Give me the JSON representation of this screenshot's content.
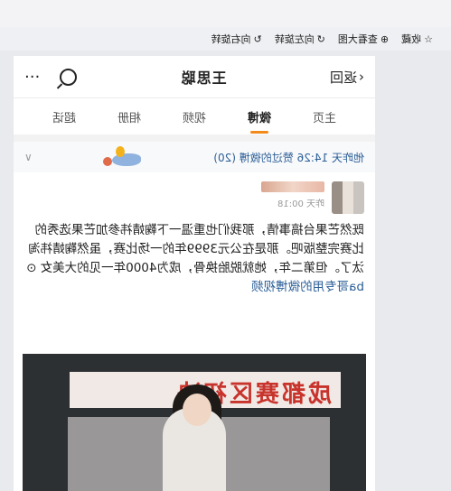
{
  "toolbar": {
    "items": [
      {
        "icon": "star-icon",
        "label": "收藏"
      },
      {
        "icon": "magnify-icon",
        "label": "查看大图"
      },
      {
        "icon": "rotate-left-icon",
        "label": "向左旋转"
      },
      {
        "icon": "rotate-right-icon",
        "label": "向右旋转"
      }
    ]
  },
  "nav": {
    "back_label": "返回",
    "title": "王思聪",
    "more": "···"
  },
  "tabs": [
    "主页",
    "微博",
    "视频",
    "相册",
    "超话"
  ],
  "active_tab": "微博",
  "banner": {
    "text": "他昨天 14:26 赞过的微博 (20)"
  },
  "post": {
    "time": "昨天 00:18",
    "body": "既然芒果台搞事情，那我们也重温一下鞠婧祎参加芒果选秀的比赛完整版吧。那是在公元3999年的一场比赛，虽然鞠婧祎淘汰了。但第二年，她就脱胎换骨，成为4000年一见的大美女",
    "link": "ba哥专用的微博视频"
  },
  "video": {
    "caption": "成都赛区初决"
  }
}
